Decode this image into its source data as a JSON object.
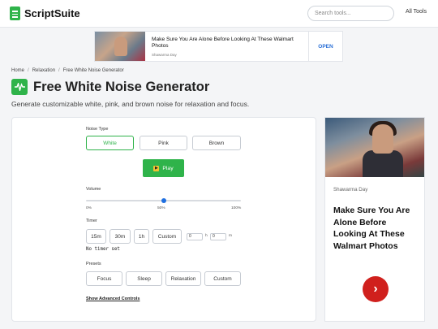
{
  "header": {
    "brand": "ScriptSuite",
    "search_placeholder": "Search tools...",
    "all_tools": "All Tools"
  },
  "top_ad": {
    "title": "Make Sure You Are Alone Before Looking At These Walmart Photos",
    "source": "Shawarma Day",
    "cta": "OPEN"
  },
  "breadcrumb": [
    "Home",
    "Relaxation",
    "Free White Noise Generator"
  ],
  "page": {
    "title": "Free White Noise Generator",
    "subtitle": "Generate customizable white, pink, and brown noise for relaxation and focus."
  },
  "generator": {
    "noise_type_label": "Noise Type",
    "noise_types": [
      "White",
      "Pink",
      "Brown"
    ],
    "selected_noise_type": "White",
    "play_label": "Play",
    "volume_label": "Volume",
    "volume_value": 0.5,
    "volume_ticks": [
      "0%",
      "50%",
      "100%"
    ],
    "timer_label": "Timer",
    "timer_options": [
      "15m",
      "30m",
      "1h",
      "Custom"
    ],
    "timer_hours": "0",
    "timer_hours_unit": "h",
    "timer_minutes": "0",
    "timer_minutes_unit": "m",
    "timer_status": "No timer set",
    "presets_label": "Presets",
    "presets": [
      "Focus",
      "Sleep",
      "Relaxation",
      "Custom"
    ],
    "advanced_link": "Show Advanced Controls"
  },
  "side_ad": {
    "source": "Shawarma Day",
    "title": "Make Sure You Are Alone Before Looking At These Walmart Photos",
    "arrow": "›"
  },
  "colors": {
    "accent": "#2fb34a",
    "slider_thumb": "#1f6fe0",
    "ad_button": "#d0201d",
    "ad_cta": "#2a6fd6"
  }
}
